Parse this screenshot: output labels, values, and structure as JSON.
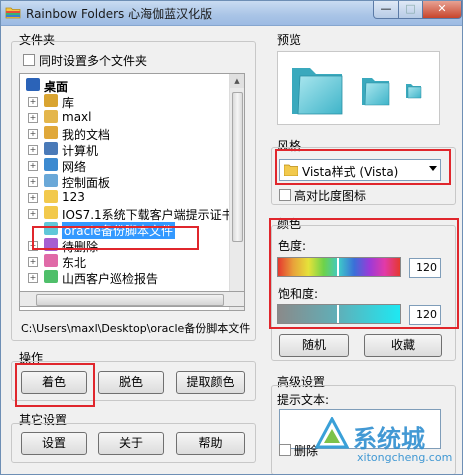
{
  "window": {
    "title": "Rainbow Folders 心海伽蓝汉化版",
    "minimize_glyph": "—",
    "maximize_glyph": "□",
    "close_glyph": "✕"
  },
  "folders": {
    "label": "文件夹",
    "multi_select_label": "同时设置多个文件夹",
    "tree": [
      {
        "label": "桌面",
        "level": 0,
        "icon": "desktop",
        "expander": "",
        "selected": false
      },
      {
        "label": "库",
        "level": 1,
        "icon": "library",
        "expander": "+",
        "selected": false
      },
      {
        "label": "maxl",
        "level": 1,
        "icon": "user-folder",
        "expander": "+",
        "selected": false
      },
      {
        "label": "我的文档",
        "level": 1,
        "icon": "documents-folder",
        "expander": "+",
        "selected": false
      },
      {
        "label": "计算机",
        "level": 1,
        "icon": "computer",
        "expander": "+",
        "selected": false
      },
      {
        "label": "网络",
        "level": 1,
        "icon": "network",
        "expander": "+",
        "selected": false
      },
      {
        "label": "控制面板",
        "level": 1,
        "icon": "control-panel",
        "expander": "+",
        "selected": false
      },
      {
        "label": "123",
        "level": 1,
        "icon": "folder",
        "expander": "+",
        "selected": false
      },
      {
        "label": "IOS7.1系统下载客户端提示证书",
        "level": 1,
        "icon": "folder",
        "expander": "+",
        "selected": false
      },
      {
        "label": "oracle备份脚本文件",
        "level": 1,
        "icon": "cyan-folder",
        "expander": "",
        "selected": true
      },
      {
        "label": "待删除",
        "level": 1,
        "icon": "purple-folder",
        "expander": "+",
        "selected": false
      },
      {
        "label": "东北",
        "level": 1,
        "icon": "pink-folder",
        "expander": "+",
        "selected": false
      },
      {
        "label": "山西客户巡检报告",
        "level": 1,
        "icon": "green-folder",
        "expander": "+",
        "selected": false
      }
    ],
    "path": "C:\\Users\\maxl\\Desktop\\oracle备份脚本文件"
  },
  "operations": {
    "label": "操作",
    "colorize_button": "着色",
    "decolorize_button": "脱色",
    "pick_color_button": "提取颜色"
  },
  "other_settings": {
    "label": "其它设置",
    "settings_button": "设置",
    "about_button": "关于",
    "help_button": "帮助"
  },
  "preview": {
    "label": "预览"
  },
  "style": {
    "label": "风格",
    "selected_option": "Vista样式 (Vista)",
    "high_contrast_label": "高对比度图标"
  },
  "color": {
    "label": "颜色",
    "hue_label": "色度:",
    "hue_value": "120",
    "saturation_label": "饱和度:",
    "saturation_value": "120",
    "random_button": "随机",
    "favorite_button": "收藏"
  },
  "advanced": {
    "label": "高级设置",
    "tooltip_label": "提示文本:",
    "delete_checkbox_label": "删除"
  },
  "watermark": {
    "brand": "系统城",
    "site": "xitongcheng.com"
  },
  "colors": {
    "selection": "#3399ff",
    "highlight": "#e0262c",
    "folder_cyan": "#5fc7d9"
  }
}
